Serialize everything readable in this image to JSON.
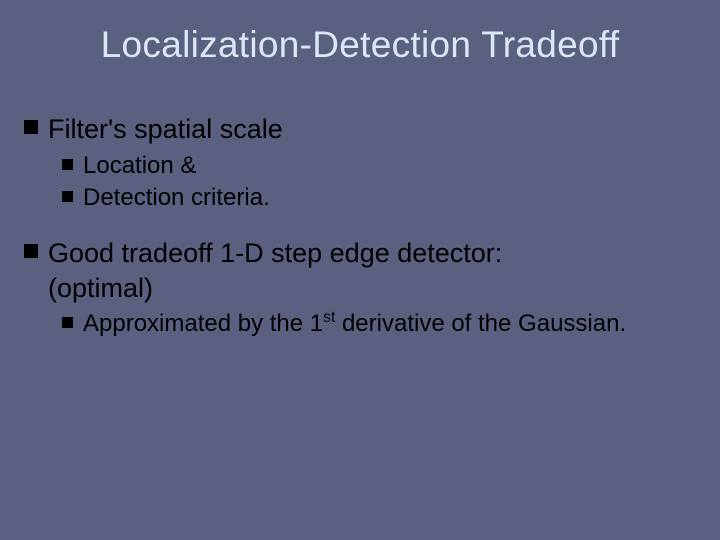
{
  "title": "Localization-Detection Tradeoff",
  "bullets": {
    "b1": {
      "text": "Filter's spatial scale"
    },
    "b1s1": {
      "text": "Location &"
    },
    "b1s2": {
      "text": "Detection criteria."
    },
    "b2": {
      "line1": "Good tradeoff 1-D step edge detector:",
      "line2": "(optimal)"
    },
    "b2s1": {
      "prefix": "Approximated by the 1",
      "sup": "st",
      "suffix": " derivative of the Gaussian."
    }
  }
}
